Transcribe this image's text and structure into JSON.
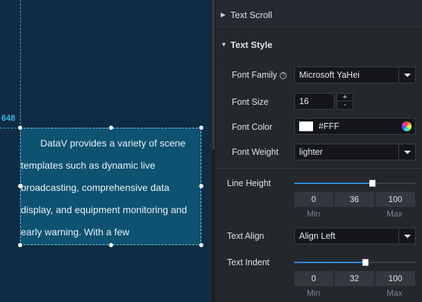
{
  "canvas": {
    "guide_value": "648",
    "textbox_content": "DataV provides a variety of scene templates such as dynamic live broadcasting, comprehensive data display, and equipment monitoring and early warning. With a few"
  },
  "panel": {
    "text_scroll_label": "Text Scroll",
    "text_style_label": "Text Style",
    "font_family": {
      "label": "Font Family",
      "help": "?",
      "value": "Microsoft YaHei"
    },
    "font_size": {
      "label": "Font Size",
      "value": "16",
      "up": "+",
      "down": "-"
    },
    "font_color": {
      "label": "Font Color",
      "value": "#FFF",
      "swatch": "#ffffff"
    },
    "font_weight": {
      "label": "Font Weight",
      "value": "lighter"
    },
    "line_height": {
      "label": "Line Height",
      "min": "0",
      "value": "36",
      "max": "100",
      "min_label": "Min",
      "max_label": "Max",
      "fraction": 0.36
    },
    "text_align": {
      "label": "Text Align",
      "value": "Align Left"
    },
    "text_indent": {
      "label": "Text Indent",
      "min": "0",
      "value": "32",
      "max": "100",
      "min_label": "Min",
      "max_label": "Max",
      "fraction": 0.32
    }
  },
  "colors": {
    "accent": "#2f8fe0",
    "canvas_bg": "#0e2c44",
    "textbox_bg": "#0d5270",
    "guide": "#3fb3dd",
    "panel_bg": "#24272c"
  }
}
